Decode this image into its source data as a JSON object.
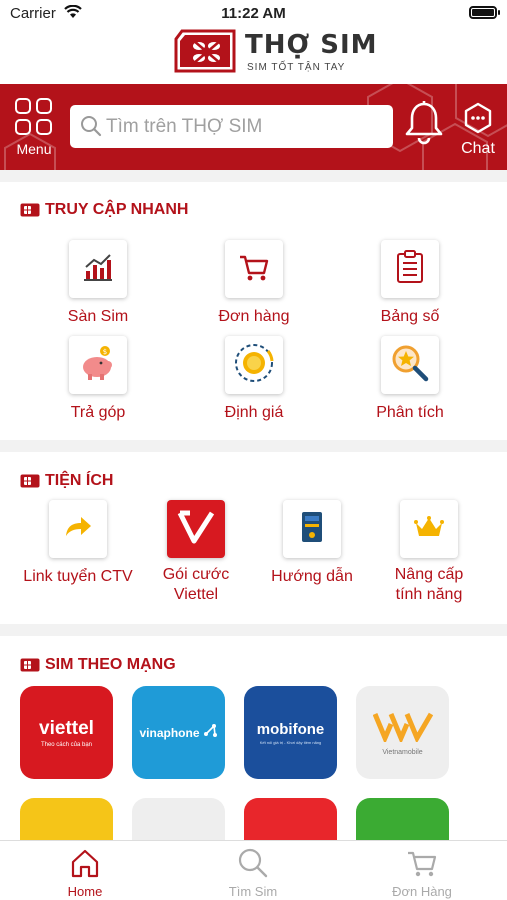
{
  "status_bar": {
    "carrier": "Carrier",
    "time": "11:22 AM"
  },
  "brand": {
    "name": "THỢ SIM",
    "tagline": "SIM TỐT TẬN TAY"
  },
  "header": {
    "menu_label": "Menu",
    "search_placeholder": "Tìm trên THỢ SIM",
    "chat_label": "Chat"
  },
  "quick_access": {
    "title": "TRUY CẬP NHANH",
    "items": [
      {
        "label": "Sàn Sim",
        "icon": "bar-chart-icon"
      },
      {
        "label": "Đơn hàng",
        "icon": "cart-icon"
      },
      {
        "label": "Bảng số",
        "icon": "clipboard-icon"
      },
      {
        "label": "Trả góp",
        "icon": "piggy-bank-icon"
      },
      {
        "label": "Định giá",
        "icon": "coin-valuation-icon"
      },
      {
        "label": "Phân tích",
        "icon": "magnify-star-icon"
      }
    ]
  },
  "utilities": {
    "title": "TIỆN ÍCH",
    "items": [
      {
        "label": "Link tuyển CTV",
        "icon": "share-arrow-icon"
      },
      {
        "label_line1": "Gói cước",
        "label_line2": "Viettel",
        "icon": "v-logo-icon"
      },
      {
        "label": "Hướng dẫn",
        "icon": "guide-book-icon"
      },
      {
        "label_line1": "Nâng cấp",
        "label_line2": "tính năng",
        "icon": "crown-icon"
      }
    ]
  },
  "networks": {
    "title": "SIM THEO MẠNG",
    "items": [
      {
        "name": "viettel",
        "sub": "Theo cách của bạn",
        "color": "#d71920"
      },
      {
        "name": "vinaphone",
        "color": "#1f9bd7"
      },
      {
        "name": "mobifone",
        "sub": "Kết nối giá trị - Khơi dậy tiềm năng",
        "color": "#1b4f9c"
      },
      {
        "name": "Vietnamobile",
        "color": "#eeeeee"
      },
      {
        "color": "#f5c518"
      },
      {
        "color": "#eeeeee"
      },
      {
        "color": "#e8262b"
      },
      {
        "color": "#3bab33"
      }
    ]
  },
  "tabs": [
    {
      "label": "Home",
      "active": true
    },
    {
      "label": "Tìm Sim",
      "active": false
    },
    {
      "label": "Đơn Hàng",
      "active": false
    }
  ],
  "colors": {
    "brand_red": "#b3121a",
    "inactive_gray": "#aaaaaa"
  }
}
